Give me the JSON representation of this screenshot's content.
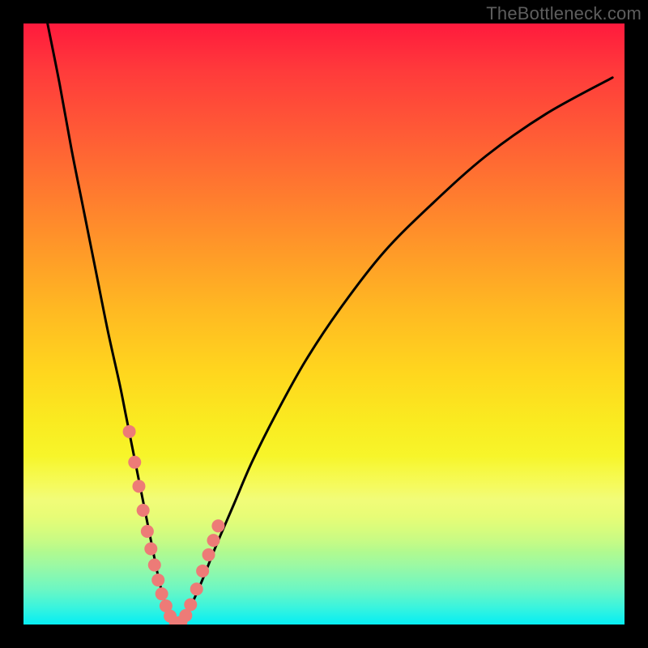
{
  "watermark": "TheBottleneck.com",
  "chart_data": {
    "type": "line",
    "title": "",
    "xlabel": "",
    "ylabel": "",
    "xlim": [
      0,
      100
    ],
    "ylim": [
      0,
      100
    ],
    "series": [
      {
        "name": "bottleneck-curve",
        "x": [
          4,
          6,
          8,
          10,
          12,
          14,
          16,
          17,
          18,
          19,
          20,
          20.8,
          21.6,
          22.3,
          23,
          23.7,
          24.4,
          25.2,
          26,
          27,
          28.5,
          30,
          32,
          35,
          38,
          42,
          47,
          53,
          60,
          68,
          77,
          87,
          98
        ],
        "y": [
          100,
          90,
          79,
          69,
          59,
          49,
          40,
          35,
          30,
          25,
          20,
          16,
          12,
          8.5,
          5.5,
          3,
          1.2,
          0.2,
          0.2,
          1.5,
          4.5,
          8,
          13,
          20,
          27,
          35,
          44,
          53,
          62,
          70,
          78,
          85,
          91
        ]
      }
    ],
    "markers": {
      "name": "highlighted-points",
      "x": [
        17.6,
        18.5,
        19.2,
        19.9,
        20.6,
        21.2,
        21.8,
        22.4,
        23.0,
        23.7,
        24.4,
        25.3,
        26.2,
        27.0,
        27.8,
        28.8,
        29.8,
        30.8,
        31.6,
        32.4
      ],
      "y": [
        32.1,
        27.0,
        23.0,
        19.0,
        15.5,
        12.6,
        9.9,
        7.4,
        5.1,
        3.1,
        1.4,
        0.3,
        0.4,
        1.5,
        3.3,
        5.9,
        8.9,
        11.6,
        14.0,
        16.4
      ],
      "color": "#ed7b77",
      "radius": 8
    },
    "curve_color": "#000000",
    "curve_width": 3
  }
}
